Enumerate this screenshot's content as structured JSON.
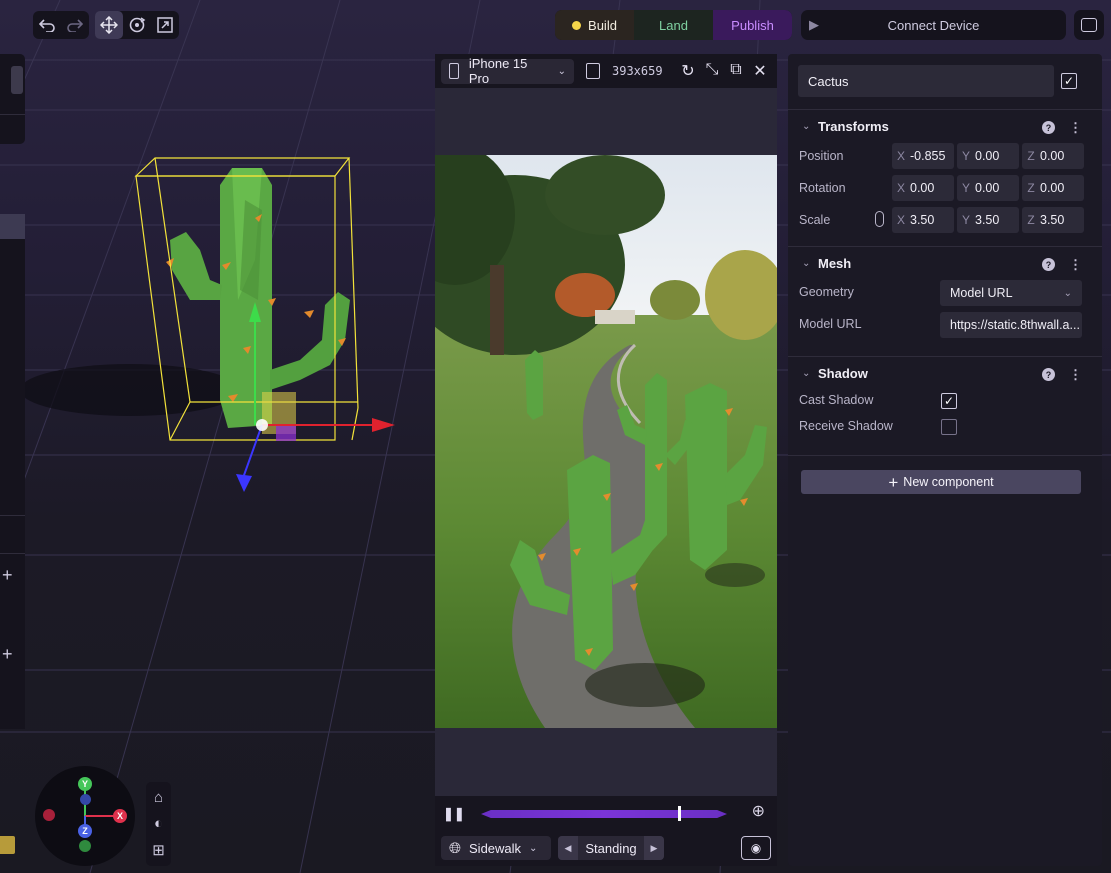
{
  "toolbar": {
    "undo_icon": "undo-icon",
    "redo_icon": "redo-icon",
    "tools": [
      "move-icon",
      "rotate-icon",
      "scale-icon"
    ]
  },
  "modes": {
    "build": "Build",
    "land": "Land",
    "publish": "Publish"
  },
  "connect": {
    "label": "Connect Device"
  },
  "simulator": {
    "device": "iPhone 15 Pro",
    "resolution": "393x659",
    "scene": "Sidewalk",
    "pose": "Standing",
    "timeline_progress": 0.8
  },
  "inspector": {
    "name": "Cactus",
    "transforms": {
      "title": "Transforms",
      "position_label": "Position",
      "rotation_label": "Rotation",
      "scale_label": "Scale",
      "position": {
        "x": "-0.855",
        "y": "0.00",
        "z": "0.00"
      },
      "rotation": {
        "x": "0.00",
        "y": "0.00",
        "z": "0.00"
      },
      "scale": {
        "x": "3.50",
        "y": "3.50",
        "z": "3.50"
      }
    },
    "mesh": {
      "title": "Mesh",
      "geometry_label": "Geometry",
      "geometry_value": "Model URL",
      "model_url_label": "Model URL",
      "model_url_value": "https://static.8thwall.a..."
    },
    "shadow": {
      "title": "Shadow",
      "cast_label": "Cast Shadow",
      "cast_checked": true,
      "receive_label": "Receive Shadow",
      "receive_checked": false
    },
    "new_component": "New component"
  },
  "axes": {
    "x": "X",
    "y": "Y",
    "z": "Z"
  },
  "gizmo": {
    "x": "X",
    "y": "Y",
    "z": "Z"
  },
  "colors": {
    "accent_purple": "#7b34d8",
    "build_dot": "#f5d54a",
    "land_text": "#7fd0a0",
    "publish_text": "#c98cff",
    "bbox_yellow": "#f2e23a"
  }
}
